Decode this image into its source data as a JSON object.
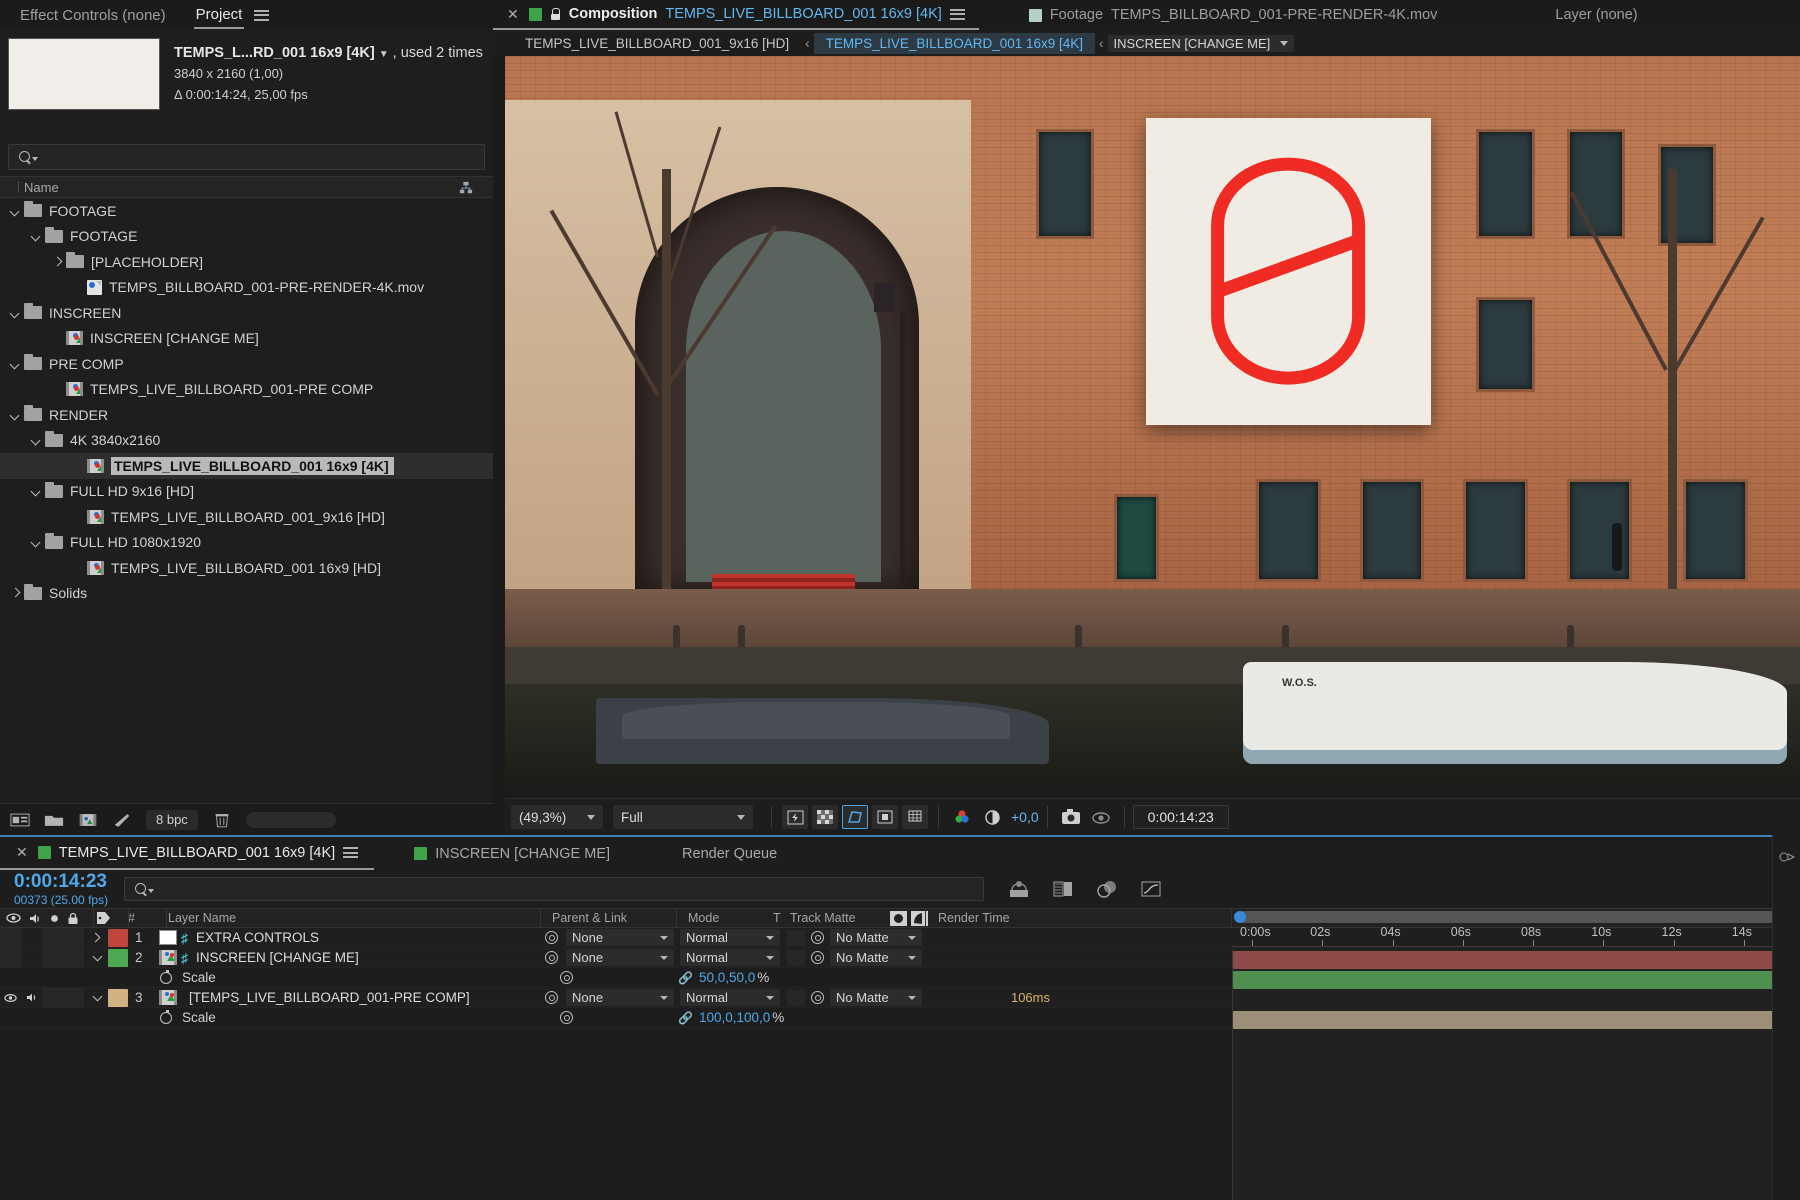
{
  "panels": {
    "effect_controls_tab": "Effect Controls (none)",
    "project_tab": "Project",
    "layer_tab": "Layer (none)"
  },
  "project": {
    "item_title": "TEMPS_L...RD_001 16x9 [4K]",
    "used_times": ", used 2 times",
    "resolution": "3840 x 2160 (1,00)",
    "duration": "Δ 0:00:14:24, 25,00 fps",
    "search_placeholder": "",
    "column_name": "Name",
    "tree": [
      {
        "label": "FOOTAGE",
        "type": "folder",
        "indent": 0,
        "twist": "down"
      },
      {
        "label": "FOOTAGE",
        "type": "folder",
        "indent": 1,
        "twist": "down"
      },
      {
        "label": "[PLACEHOLDER]",
        "type": "folder",
        "indent": 2,
        "twist": "right"
      },
      {
        "label": "TEMPS_BILLBOARD_001-PRE-RENDER-4K.mov",
        "type": "movie",
        "indent": 3,
        "twist": "none"
      },
      {
        "label": "INSCREEN",
        "type": "folder",
        "indent": 0,
        "twist": "down"
      },
      {
        "label": "INSCREEN [CHANGE ME]",
        "type": "comp",
        "indent": 2,
        "twist": "none"
      },
      {
        "label": "PRE COMP",
        "type": "folder",
        "indent": 0,
        "twist": "down"
      },
      {
        "label": "TEMPS_LIVE_BILLBOARD_001-PRE COMP",
        "type": "comp",
        "indent": 2,
        "twist": "none"
      },
      {
        "label": "RENDER",
        "type": "folder",
        "indent": 0,
        "twist": "down"
      },
      {
        "label": "4K 3840x2160",
        "type": "folder",
        "indent": 1,
        "twist": "down"
      },
      {
        "label": "TEMPS_LIVE_BILLBOARD_001 16x9 [4K]",
        "type": "comp",
        "indent": 3,
        "twist": "none",
        "selected": true
      },
      {
        "label": "FULL HD 9x16 [HD]",
        "type": "folder",
        "indent": 1,
        "twist": "down"
      },
      {
        "label": "TEMPS_LIVE_BILLBOARD_001_9x16  [HD]",
        "type": "comp",
        "indent": 3,
        "twist": "none"
      },
      {
        "label": "FULL HD 1080x1920",
        "type": "folder",
        "indent": 1,
        "twist": "down"
      },
      {
        "label": "TEMPS_LIVE_BILLBOARD_001 16x9 [HD]",
        "type": "comp",
        "indent": 3,
        "twist": "none"
      },
      {
        "label": "Solids",
        "type": "folder",
        "indent": 0,
        "twist": "right"
      }
    ],
    "footer": {
      "bpc": "8 bpc"
    }
  },
  "viewer": {
    "tabs": [
      {
        "prefix": "Composition",
        "title": "TEMPS_LIVE_BILLBOARD_001 16x9 [4K]",
        "active": true
      },
      {
        "prefix": "Footage",
        "title": "TEMPS_BILLBOARD_001-PRE-RENDER-4K.mov",
        "active": false
      }
    ],
    "subtabs": [
      {
        "label": "TEMPS_LIVE_BILLBOARD_001_9x16 [HD]",
        "active": false
      },
      {
        "label": "TEMPS_LIVE_BILLBOARD_001 16x9 [4K]",
        "active": true
      },
      {
        "label": "INSCREEN [CHANGE ME]",
        "active": false,
        "dropdown": true
      }
    ],
    "toolbar": {
      "zoom": "(49,3%)",
      "resolution": "Full",
      "exposure": "+0,0",
      "timecode": "0:00:14:23"
    },
    "billboard_logo_color": "#ef2b24",
    "boat_label": "W.O.S."
  },
  "timeline": {
    "tabs": [
      {
        "label": "TEMPS_LIVE_BILLBOARD_001 16x9 [4K]",
        "active": true,
        "color": "#3fa34a"
      },
      {
        "label": "INSCREEN [CHANGE ME]",
        "active": false,
        "color": "#3fa34a"
      },
      {
        "label": "Render Queue",
        "active": false
      }
    ],
    "timecode": "0:00:14:23",
    "frame_info": "00373 (25.00 fps)",
    "search_placeholder": "",
    "columns": {
      "num": "#",
      "layer_name": "Layer Name",
      "parent_link": "Parent & Link",
      "mode": "Mode",
      "t": "T",
      "track_matte": "Track Matte",
      "render_time": "Render Time"
    },
    "layers": [
      {
        "num": "1",
        "name": "EXTRA CONTROLS",
        "color": "#c0453d",
        "source_icon": "white-solid-icon",
        "twist": "right",
        "visible": false,
        "audio": false,
        "parent": "None",
        "mode": "Normal",
        "matte": "No Matte",
        "render_time": "",
        "bar_color": "#8d4a47",
        "bar_start_pct": 0,
        "bar_width_pct": 100
      },
      {
        "num": "2",
        "name": "INSCREEN [CHANGE ME]",
        "color": "#4fa852",
        "source_icon": "comp-icon",
        "twist": "down",
        "visible": false,
        "audio": false,
        "parent": "None",
        "mode": "Normal",
        "matte": "No Matte",
        "render_time": "",
        "bar_color": "#4f8f4f",
        "bar_start_pct": 0,
        "bar_width_pct": 100,
        "property": {
          "name": "Scale",
          "value": "50,0,50,0",
          "unit": "%"
        }
      },
      {
        "num": "3",
        "name": "[TEMPS_LIVE_BILLBOARD_001-PRE COMP]",
        "color": "#d2b183",
        "source_icon": "comp-icon",
        "twist": "down",
        "visible": true,
        "audio": true,
        "parent": "None",
        "mode": "Normal",
        "matte": "No Matte",
        "render_time": "106ms",
        "bar_color": "#9d8e77",
        "bar_start_pct": 0,
        "bar_width_pct": 100,
        "property": {
          "name": "Scale",
          "value": "100,0,100,0",
          "unit": "%"
        }
      }
    ],
    "ruler_ticks": [
      "0:00s",
      "02s",
      "04s",
      "06s",
      "08s",
      "10s",
      "12s",
      "14s"
    ]
  },
  "colors": {
    "accent_blue": "#4fa8e8",
    "panel_bg": "#1d1d1d",
    "logo_red": "#ef2b24"
  }
}
